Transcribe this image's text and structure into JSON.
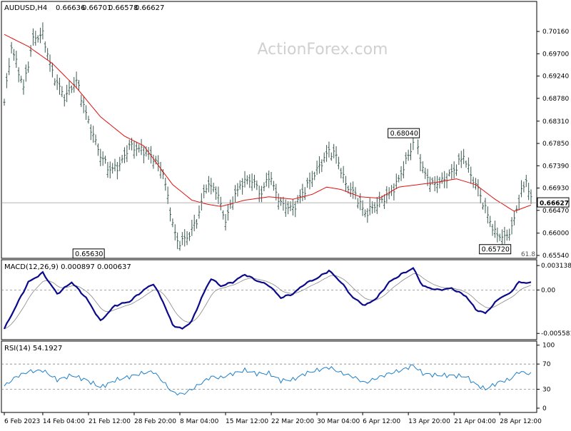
{
  "chart_data": {
    "type": "line",
    "panel_title": "AUDUSD,H4",
    "ohlc": {
      "open": "0.66636",
      "high": "0.66701",
      "low": "0.66578",
      "close": "0.66627"
    },
    "watermark": "ActionForex.com",
    "price_axis": {
      "ticks": [
        0.7016,
        0.697,
        0.6924,
        0.6878,
        0.6831,
        0.6785,
        0.6739,
        0.6693,
        0.6647,
        0.66,
        0.6554
      ],
      "ylim": [
        0.6551,
        0.7075
      ]
    },
    "current_price": 0.66627,
    "current_price_label": "0.66627",
    "fib_label": "61.8",
    "annotations": [
      {
        "label": "0.65630",
        "value": 0.6563,
        "bar": 41
      },
      {
        "label": "0.68040",
        "value": 0.6804,
        "bar": 172
      },
      {
        "label": "0.65720",
        "value": 0.6572,
        "bar": 210
      }
    ],
    "x_axis": {
      "labels": [
        {
          "text": "6 Feb 2023",
          "bar": 0
        },
        {
          "text": "14 Feb 04:00",
          "bar": 16
        },
        {
          "text": "21 Feb 12:00",
          "bar": 35
        },
        {
          "text": "28 Feb 20:00",
          "bar": 54
        },
        {
          "text": "8 Mar 04:00",
          "bar": 73
        },
        {
          "text": "15 Mar 12:00",
          "bar": 92
        },
        {
          "text": "22 Mar 20:00",
          "bar": 111
        },
        {
          "text": "30 Mar 04:00",
          "bar": 130
        },
        {
          "text": "6 Apr 12:00",
          "bar": 149
        },
        {
          "text": "13 Apr 20:00",
          "bar": 168
        },
        {
          "text": "21 Apr 04:00",
          "bar": 187
        },
        {
          "text": "28 Apr 12:00",
          "bar": 206
        }
      ],
      "bar_count": 220
    },
    "price_keypoints": [
      [
        0,
        0.687
      ],
      [
        3,
        0.6985
      ],
      [
        8,
        0.69
      ],
      [
        12,
        0.7
      ],
      [
        16,
        0.701
      ],
      [
        20,
        0.693
      ],
      [
        25,
        0.688
      ],
      [
        30,
        0.6915
      ],
      [
        35,
        0.683
      ],
      [
        40,
        0.676
      ],
      [
        44,
        0.673
      ],
      [
        48,
        0.674
      ],
      [
        52,
        0.678
      ],
      [
        58,
        0.677
      ],
      [
        62,
        0.6755
      ],
      [
        66,
        0.6725
      ],
      [
        70,
        0.662
      ],
      [
        72,
        0.658
      ],
      [
        76,
        0.659
      ],
      [
        80,
        0.6625
      ],
      [
        84,
        0.67
      ],
      [
        88,
        0.669
      ],
      [
        92,
        0.6625
      ],
      [
        95,
        0.667
      ],
      [
        99,
        0.6705
      ],
      [
        103,
        0.671
      ],
      [
        107,
        0.668
      ],
      [
        110,
        0.672
      ],
      [
        115,
        0.666
      ],
      [
        120,
        0.665
      ],
      [
        125,
        0.669
      ],
      [
        130,
        0.673
      ],
      [
        135,
        0.677
      ],
      [
        138,
        0.676
      ],
      [
        142,
        0.67
      ],
      [
        146,
        0.668
      ],
      [
        150,
        0.664
      ],
      [
        155,
        0.666
      ],
      [
        160,
        0.668
      ],
      [
        163,
        0.67
      ],
      [
        168,
        0.676
      ],
      [
        171,
        0.68
      ],
      [
        174,
        0.673
      ],
      [
        178,
        0.67
      ],
      [
        183,
        0.671
      ],
      [
        187,
        0.673
      ],
      [
        191,
        0.676
      ],
      [
        194,
        0.672
      ],
      [
        197,
        0.669
      ],
      [
        200,
        0.665
      ],
      [
        204,
        0.66
      ],
      [
        208,
        0.659
      ],
      [
        211,
        0.661
      ],
      [
        214,
        0.667
      ],
      [
        217,
        0.671
      ],
      [
        219,
        0.6668
      ]
    ],
    "moving_average_keypoints": [
      [
        0,
        0.701
      ],
      [
        10,
        0.6985
      ],
      [
        20,
        0.695
      ],
      [
        30,
        0.69
      ],
      [
        40,
        0.684
      ],
      [
        50,
        0.68
      ],
      [
        58,
        0.678
      ],
      [
        64,
        0.674
      ],
      [
        70,
        0.67
      ],
      [
        78,
        0.6668
      ],
      [
        84,
        0.666
      ],
      [
        90,
        0.6655
      ],
      [
        100,
        0.6668
      ],
      [
        110,
        0.6675
      ],
      [
        120,
        0.667
      ],
      [
        128,
        0.668
      ],
      [
        134,
        0.6695
      ],
      [
        140,
        0.669
      ],
      [
        148,
        0.6675
      ],
      [
        156,
        0.6672
      ],
      [
        164,
        0.6695
      ],
      [
        172,
        0.67
      ],
      [
        180,
        0.6705
      ],
      [
        188,
        0.6712
      ],
      [
        196,
        0.67
      ],
      [
        204,
        0.667
      ],
      [
        212,
        0.6645
      ],
      [
        219,
        0.6658
      ]
    ],
    "macd": {
      "label": "MACD(12,26,9) 0.000897 0.000637",
      "ticks_text": [
        "0.003138",
        "0.00",
        "-0.005581"
      ],
      "ticks": [
        0.003138,
        0.0,
        -0.005581
      ],
      "ylim": [
        -0.0062,
        0.0037
      ],
      "keypoints": [
        [
          0,
          -0.005
        ],
        [
          5,
          -0.002
        ],
        [
          10,
          0.001
        ],
        [
          16,
          0.0022
        ],
        [
          22,
          -0.0005
        ],
        [
          28,
          0.001
        ],
        [
          34,
          -0.001
        ],
        [
          40,
          -0.004
        ],
        [
          46,
          -0.002
        ],
        [
          52,
          -0.0015
        ],
        [
          58,
          0.0
        ],
        [
          62,
          0.0008
        ],
        [
          66,
          -0.0015
        ],
        [
          70,
          -0.0045
        ],
        [
          74,
          -0.005
        ],
        [
          78,
          -0.004
        ],
        [
          82,
          -0.001
        ],
        [
          86,
          0.0015
        ],
        [
          90,
          0.0005
        ],
        [
          95,
          0.001
        ],
        [
          100,
          0.002
        ],
        [
          105,
          0.0012
        ],
        [
          110,
          0.0006
        ],
        [
          115,
          -0.001
        ],
        [
          120,
          -0.0005
        ],
        [
          125,
          0.0008
        ],
        [
          130,
          0.0015
        ],
        [
          135,
          0.0025
        ],
        [
          140,
          0.001
        ],
        [
          145,
          -0.001
        ],
        [
          150,
          -0.002
        ],
        [
          155,
          -0.001
        ],
        [
          160,
          0.001
        ],
        [
          165,
          0.002
        ],
        [
          170,
          0.0028
        ],
        [
          174,
          0.0005
        ],
        [
          180,
          0.0
        ],
        [
          186,
          0.0002
        ],
        [
          192,
          -0.0008
        ],
        [
          196,
          -0.0025
        ],
        [
          200,
          -0.003
        ],
        [
          206,
          -0.001
        ],
        [
          210,
          -0.0005
        ],
        [
          214,
          0.001
        ],
        [
          219,
          0.0009
        ]
      ]
    },
    "rsi": {
      "label": "RSI(14) 54.1927",
      "ticks": [
        100,
        70,
        30,
        0
      ],
      "ylim": [
        0,
        100
      ],
      "keypoints": [
        [
          0,
          35
        ],
        [
          5,
          50
        ],
        [
          10,
          58
        ],
        [
          16,
          60
        ],
        [
          22,
          45
        ],
        [
          28,
          52
        ],
        [
          34,
          45
        ],
        [
          40,
          33
        ],
        [
          46,
          44
        ],
        [
          52,
          50
        ],
        [
          58,
          56
        ],
        [
          62,
          58
        ],
        [
          66,
          42
        ],
        [
          70,
          25
        ],
        [
          74,
          22
        ],
        [
          78,
          30
        ],
        [
          82,
          40
        ],
        [
          86,
          50
        ],
        [
          90,
          48
        ],
        [
          95,
          55
        ],
        [
          100,
          60
        ],
        [
          105,
          55
        ],
        [
          110,
          55
        ],
        [
          115,
          44
        ],
        [
          120,
          45
        ],
        [
          125,
          55
        ],
        [
          130,
          60
        ],
        [
          135,
          65
        ],
        [
          140,
          56
        ],
        [
          145,
          50
        ],
        [
          150,
          40
        ],
        [
          155,
          48
        ],
        [
          160,
          55
        ],
        [
          165,
          60
        ],
        [
          170,
          68
        ],
        [
          174,
          55
        ],
        [
          180,
          52
        ],
        [
          186,
          52
        ],
        [
          192,
          50
        ],
        [
          196,
          38
        ],
        [
          200,
          30
        ],
        [
          206,
          42
        ],
        [
          210,
          45
        ],
        [
          214,
          58
        ],
        [
          219,
          54
        ]
      ]
    },
    "colors": {
      "price": "#3a5a50",
      "ma": "#e01010",
      "macd": "#0a0a8a",
      "signal": "#888888",
      "rsi": "#1e7fc8",
      "grid": "#888888",
      "frame": "#000000"
    }
  }
}
